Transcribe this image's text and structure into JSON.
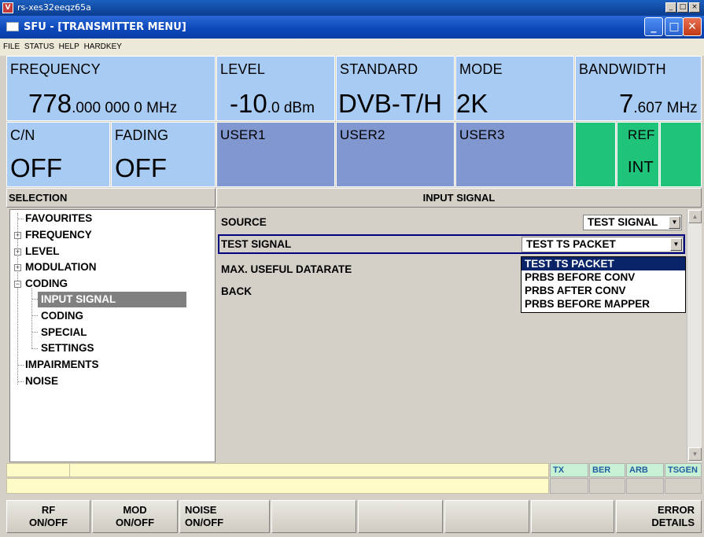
{
  "outer_window": {
    "title": "rs-xes32eeqz65a",
    "logo": "V"
  },
  "inner_window": {
    "title": "SFU - [TRANSMITTER MENU]"
  },
  "menubar": {
    "items": [
      "FILE",
      "STATUS",
      "HELP",
      "HARDKEY"
    ]
  },
  "header": {
    "frequency": {
      "label": "FREQUENCY",
      "value_main": "778",
      "value_small1": ".000 000 0",
      "unit": " MHz"
    },
    "level": {
      "label": "LEVEL",
      "value_main": "-10",
      "value_small": ".0 dBm"
    },
    "standard": {
      "label": "STANDARD",
      "value": "DVB-T/H"
    },
    "mode": {
      "label": "MODE",
      "value": "2K"
    },
    "bandwidth": {
      "label": "BANDWIDTH",
      "value_main": "7",
      "value_small": ".607 MHz"
    },
    "cn": {
      "label": "C/N",
      "value": "OFF"
    },
    "fading": {
      "label": "FADING",
      "value": "OFF"
    },
    "user1": {
      "label": "USER1"
    },
    "user2": {
      "label": "USER2"
    },
    "user3": {
      "label": "USER3"
    },
    "ref": {
      "label": "REF",
      "value": "INT"
    }
  },
  "selection": {
    "header": "SELECTION",
    "tree": [
      {
        "label": "FAVOURITES"
      },
      {
        "label": "FREQUENCY"
      },
      {
        "label": "LEVEL"
      },
      {
        "label": "MODULATION"
      },
      {
        "label": "CODING"
      },
      {
        "label": "INPUT SIGNAL"
      },
      {
        "label": "CODING"
      },
      {
        "label": "SPECIAL"
      },
      {
        "label": "SETTINGS"
      },
      {
        "label": "IMPAIRMENTS"
      },
      {
        "label": "NOISE"
      }
    ]
  },
  "input_signal": {
    "header": "INPUT SIGNAL",
    "source_label": "SOURCE",
    "source_value": "TEST SIGNAL",
    "test_signal_label": "TEST SIGNAL",
    "test_signal_value": "TEST TS PACKET",
    "max_datarate_label": "MAX. USEFUL DATARATE",
    "back_label": "BACK",
    "dropdown_options": [
      "TEST TS PACKET",
      "PRBS BEFORE CONV",
      "PRBS AFTER CONV",
      "PRBS BEFORE MAPPER"
    ]
  },
  "indicators": [
    "TX",
    "BER",
    "ARB",
    "TSGEN"
  ],
  "softkeys": [
    {
      "label": "RF\nON/OFF"
    },
    {
      "label": "MOD\nON/OFF"
    },
    {
      "label": "NOISE\nON/OFF"
    },
    {
      "label": ""
    },
    {
      "label": ""
    },
    {
      "label": ""
    },
    {
      "label": ""
    },
    {
      "label": "ERROR\nDETAILS"
    }
  ],
  "colors": {
    "header_blue": "#a8cbf3",
    "user_blue": "#8097cf",
    "status_green": "#1fc37a",
    "highlight": "#0a246a"
  }
}
